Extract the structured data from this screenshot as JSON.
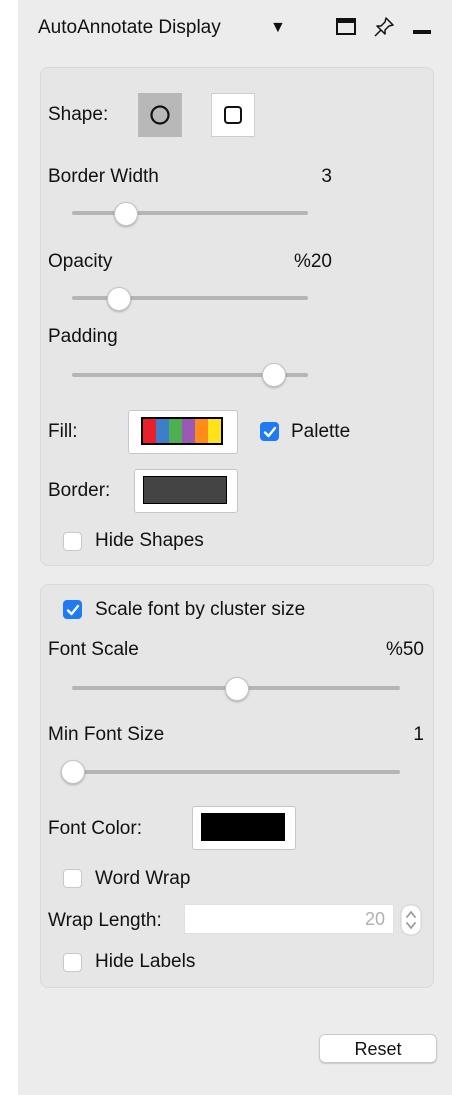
{
  "header": {
    "title": "AutoAnnotate Display"
  },
  "shape_section": {
    "shape_label": "Shape:",
    "border_width": {
      "label": "Border Width",
      "value": "3",
      "level": 0.2
    },
    "opacity": {
      "label": "Opacity",
      "value": "%20",
      "level": 0.18
    },
    "padding": {
      "label": "Padding",
      "level": 0.9
    },
    "fill": {
      "label": "Fill:",
      "palette_colors": [
        "#e8202a",
        "#3d7dc9",
        "#4caf50",
        "#9b59b6",
        "#ff8c1a",
        "#ffe31a"
      ],
      "palette_label": "Palette",
      "palette_checked": true
    },
    "border": {
      "label": "Border:",
      "color": "#444444"
    },
    "hide_shapes": {
      "label": "Hide Shapes",
      "checked": false
    }
  },
  "label_section": {
    "scale_font": {
      "label": "Scale font by cluster size",
      "checked": true
    },
    "font_scale": {
      "label": "Font Scale",
      "value": "%50",
      "level": 0.5
    },
    "min_font_size": {
      "label": "Min Font Size",
      "value": "1",
      "level": 0.0
    },
    "font_color": {
      "label": "Font Color:",
      "color": "#000000"
    },
    "word_wrap": {
      "label": "Word Wrap",
      "checked": false
    },
    "wrap_length": {
      "label": "Wrap Length:",
      "value": "20"
    },
    "hide_labels": {
      "label": "Hide Labels",
      "checked": false
    }
  },
  "footer": {
    "reset_label": "Reset"
  }
}
